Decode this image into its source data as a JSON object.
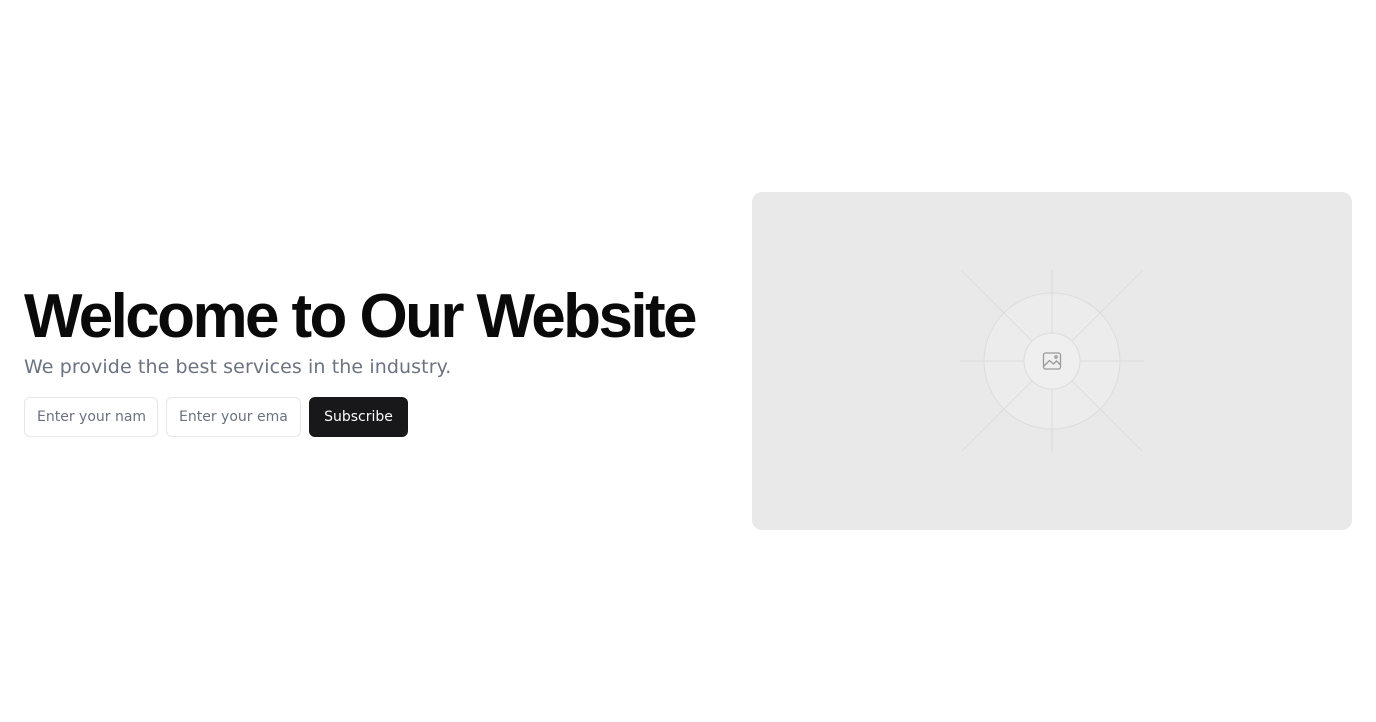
{
  "hero": {
    "title": "Welcome to Our Website",
    "subtitle": "We provide the best services in the industry."
  },
  "form": {
    "name_placeholder": "Enter your name",
    "email_placeholder": "Enter your email",
    "subscribe_label": "Subscribe"
  },
  "media": {
    "icon": "image-icon"
  },
  "colors": {
    "button_bg": "#18181b",
    "placeholder_bg": "#e9e9e9",
    "subtitle": "#6b7280"
  }
}
